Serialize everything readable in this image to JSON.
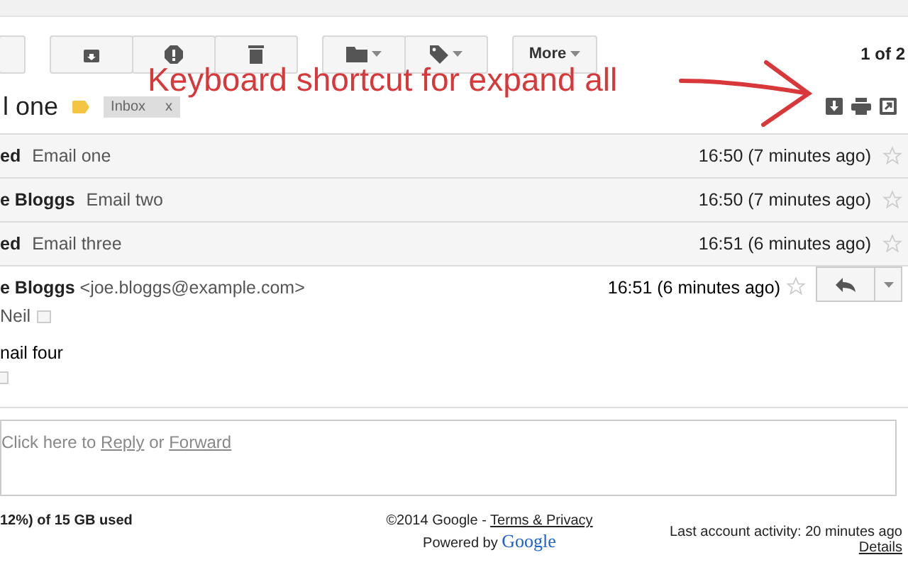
{
  "toolbar": {
    "groups": [
      {
        "buttons": [
          {
            "kind": "archive"
          },
          {
            "kind": "spam"
          },
          {
            "kind": "delete"
          }
        ]
      },
      {
        "buttons": [
          {
            "kind": "folder"
          },
          {
            "kind": "tag"
          }
        ]
      }
    ],
    "more": "More",
    "pager": "1 of 2"
  },
  "subject": {
    "title": "l one",
    "labels": [
      {
        "text": "Inbox",
        "remove": "x"
      }
    ]
  },
  "annotation": "Keyboard shortcut for expand all",
  "collapsed": [
    {
      "sender": "ed",
      "snippet": "Email one",
      "time": "16:50 (7 minutes ago)",
      "starred": false
    },
    {
      "sender": "e Bloggs",
      "snippet": "Email two",
      "time": "16:50 (7 minutes ago)",
      "starred": false
    },
    {
      "sender": "ed",
      "snippet": "Email three",
      "time": "16:51 (6 minutes ago)",
      "starred": false
    }
  ],
  "open_message": {
    "sender": "e Bloggs",
    "address": "<joe.bloggs@example.com>",
    "to": "Neil",
    "body": "nail four",
    "time": "16:51 (6 minutes ago)",
    "starred": false
  },
  "reply_box": {
    "prefix": "Click here to",
    "reply": "Reply",
    "middle": "or",
    "forward": "Forward"
  },
  "footer": {
    "storage": "12%) of 15 GB used",
    "copyright": "©2014 Google -",
    "terms": "Terms & Privacy",
    "powered": "Powered by",
    "logo": "Google",
    "activity": "Last account activity: 20 minutes ago",
    "details": "Details"
  }
}
